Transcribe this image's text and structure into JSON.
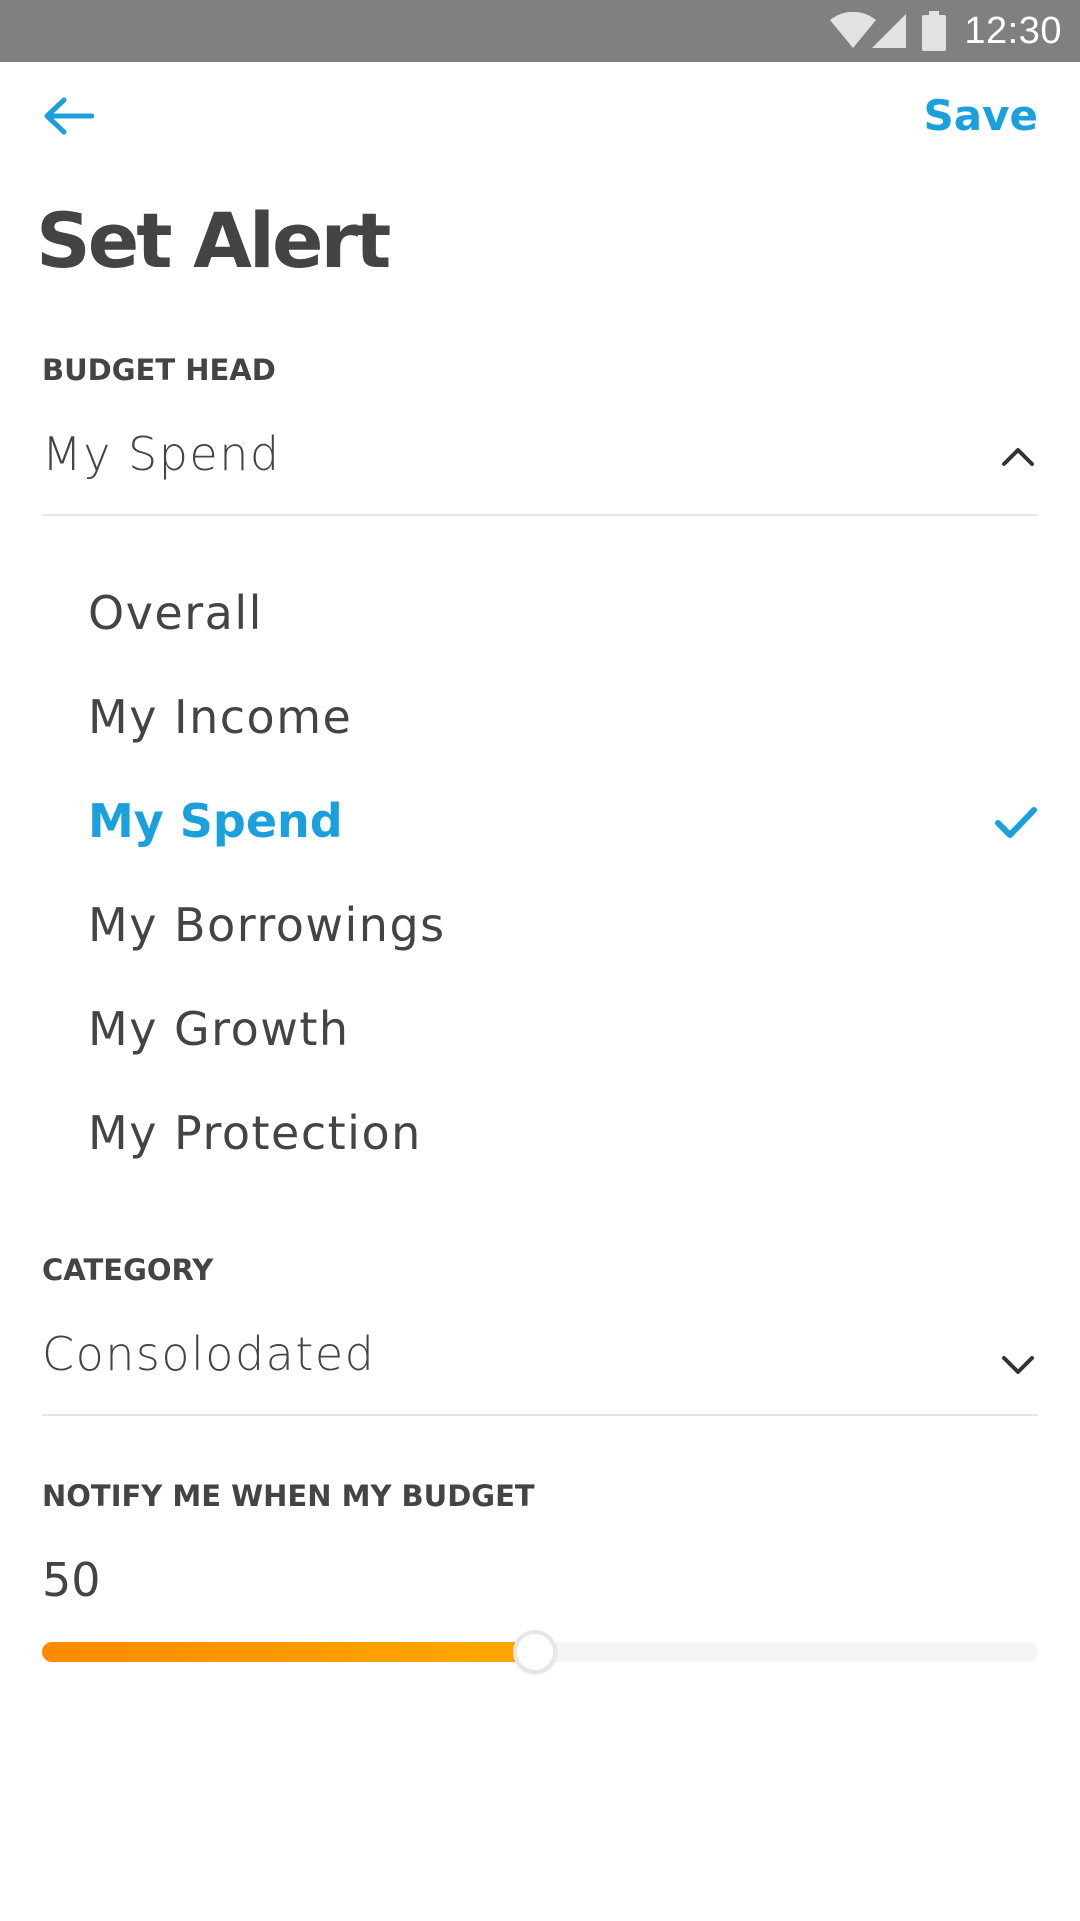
{
  "status_bar": {
    "time": "12:30",
    "icons": [
      "wifi-icon",
      "cell-signal-icon",
      "battery-icon"
    ]
  },
  "app_bar": {
    "back_icon": "arrow-left-icon",
    "save_label": "Save"
  },
  "page": {
    "title": "Set Alert"
  },
  "budget_head": {
    "label": "BUDGET HEAD",
    "value": "My Spend",
    "expanded": true,
    "options": [
      {
        "label": "Overall",
        "selected": false
      },
      {
        "label": "My Income",
        "selected": false
      },
      {
        "label": "My Spend",
        "selected": true
      },
      {
        "label": "My Borrowings",
        "selected": false
      },
      {
        "label": "My Growth",
        "selected": false
      },
      {
        "label": "My Protection",
        "selected": false
      }
    ]
  },
  "category": {
    "label": "CATEGORY",
    "value": "Consolodated",
    "expanded": false
  },
  "notify": {
    "label": "NOTIFY ME WHEN MY BUDGET",
    "value": "50",
    "slider_fraction": 0.495
  },
  "colors": {
    "accent": "#1aa0dc",
    "text": "#444444",
    "status_bar": "#808080",
    "slider_start": "#ff8a00",
    "slider_end": "#ffa900",
    "divider": "#e6e6e6"
  }
}
